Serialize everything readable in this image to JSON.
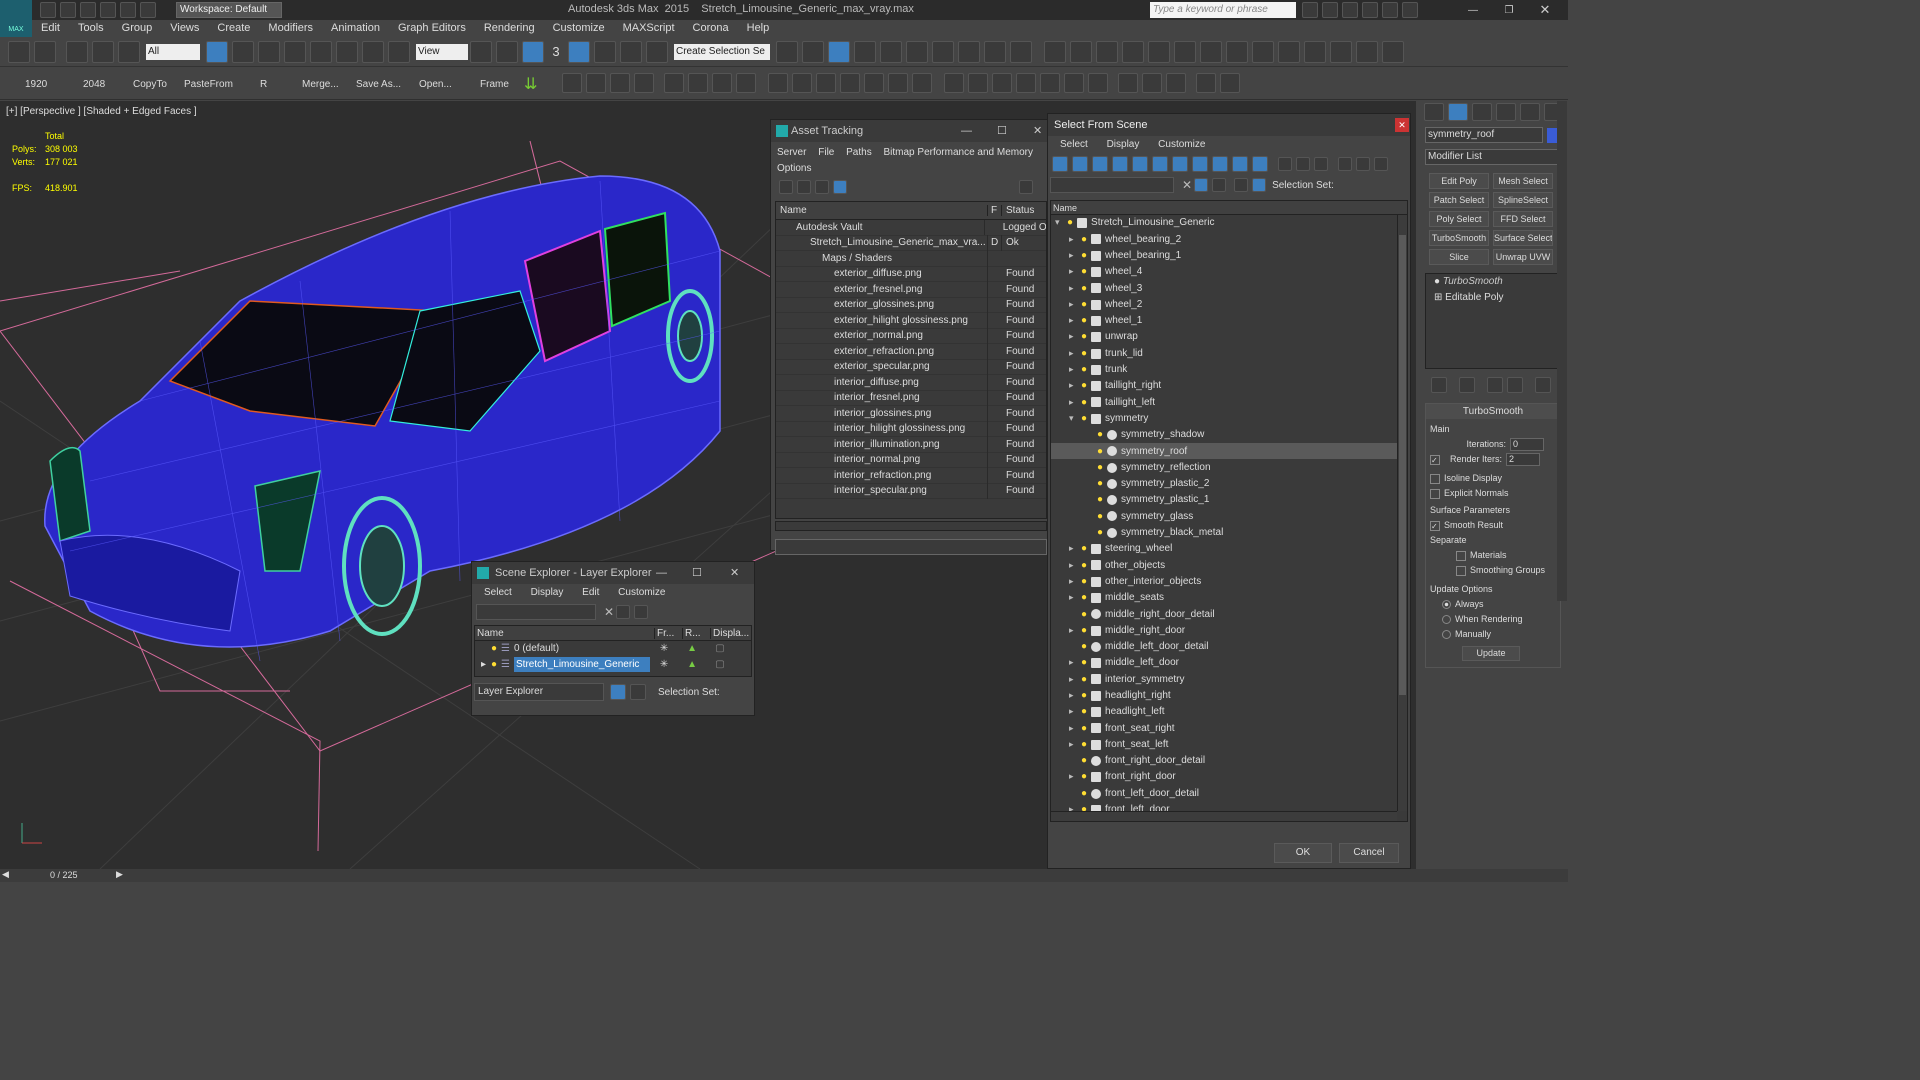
{
  "app": {
    "title": "Autodesk 3ds Max  2015    Stretch_Limousine_Generic_max_vray.max",
    "workspace": "Workspace: Default",
    "search_placeholder": "Type a keyword or phrase",
    "logo": "MAX"
  },
  "menu": [
    "Edit",
    "Tools",
    "Group",
    "Views",
    "Create",
    "Modifiers",
    "Animation",
    "Graph Editors",
    "Rendering",
    "Customize",
    "MAXScript",
    "Corona",
    "Help"
  ],
  "toolbar1": {
    "selection_filter": "All",
    "ref_coord": "View",
    "named_selection": "Create Selection Se",
    "snap_label": "3"
  },
  "toolbar2": {
    "items": [
      "1920",
      "2048",
      "CopyTo",
      "PasteFrom",
      "R",
      "Merge...",
      "Save As...",
      "Open...",
      "Frame"
    ]
  },
  "viewport": {
    "label": "[+] [Perspective ] [Shaded + Edged Faces ]",
    "stats": {
      "total_label": "Total",
      "polys_label": "Polys:",
      "polys": "308 003",
      "verts_label": "Verts:",
      "verts": "177 021",
      "fps_label": "FPS:",
      "fps": "418.901"
    }
  },
  "asset_tracking": {
    "title": "Asset Tracking",
    "menu": [
      "Server",
      "File",
      "Paths",
      "Bitmap Performance and Memory",
      "Options"
    ],
    "columns": [
      "Name",
      "F",
      "Status"
    ],
    "rows": [
      {
        "name": "Autodesk Vault",
        "f": "",
        "status": "Logged O"
      },
      {
        "name": "Stretch_Limousine_Generic_max_vra...",
        "f": "D",
        "status": "Ok"
      },
      {
        "name": "Maps / Shaders",
        "f": "",
        "status": ""
      },
      {
        "name": "exterior_diffuse.png",
        "f": "",
        "status": "Found"
      },
      {
        "name": "exterior_fresnel.png",
        "f": "",
        "status": "Found"
      },
      {
        "name": "exterior_glossines.png",
        "f": "",
        "status": "Found"
      },
      {
        "name": "exterior_hilight glossiness.png",
        "f": "",
        "status": "Found"
      },
      {
        "name": "exterior_normal.png",
        "f": "",
        "status": "Found"
      },
      {
        "name": "exterior_refraction.png",
        "f": "",
        "status": "Found"
      },
      {
        "name": "exterior_specular.png",
        "f": "",
        "status": "Found"
      },
      {
        "name": "interior_diffuse.png",
        "f": "",
        "status": "Found"
      },
      {
        "name": "interior_fresnel.png",
        "f": "",
        "status": "Found"
      },
      {
        "name": "interior_glossines.png",
        "f": "",
        "status": "Found"
      },
      {
        "name": "interior_hilight glossiness.png",
        "f": "",
        "status": "Found"
      },
      {
        "name": "interior_illumination.png",
        "f": "",
        "status": "Found"
      },
      {
        "name": "interior_normal.png",
        "f": "",
        "status": "Found"
      },
      {
        "name": "interior_refraction.png",
        "f": "",
        "status": "Found"
      },
      {
        "name": "interior_specular.png",
        "f": "",
        "status": "Found"
      }
    ]
  },
  "scene_explorer": {
    "title": "Scene Explorer - Layer Explorer",
    "menu": [
      "Select",
      "Display",
      "Edit",
      "Customize"
    ],
    "columns": [
      "Name",
      "Fr...",
      "R...",
      "Displa..."
    ],
    "rows": [
      "0 (default)",
      "Stretch_Limousine_Generic"
    ],
    "footer_mode": "Layer Explorer",
    "selection_set_label": "Selection Set:"
  },
  "select_from_scene": {
    "title": "Select From Scene",
    "menu": [
      "Select",
      "Display",
      "Customize"
    ],
    "selection_set_label": "Selection Set:",
    "column": "Name",
    "items": [
      {
        "name": "Stretch_Limousine_Generic",
        "level": 0,
        "exp": "v"
      },
      {
        "name": "wheel_bearing_2",
        "level": 1,
        "exp": ">"
      },
      {
        "name": "wheel_bearing_1",
        "level": 1,
        "exp": ">"
      },
      {
        "name": "wheel_4",
        "level": 1,
        "exp": ">"
      },
      {
        "name": "wheel_3",
        "level": 1,
        "exp": ">"
      },
      {
        "name": "wheel_2",
        "level": 1,
        "exp": ">"
      },
      {
        "name": "wheel_1",
        "level": 1,
        "exp": ">"
      },
      {
        "name": "unwrap",
        "level": 1,
        "exp": ">"
      },
      {
        "name": "trunk_lid",
        "level": 1,
        "exp": ">"
      },
      {
        "name": "trunk",
        "level": 1,
        "exp": ">"
      },
      {
        "name": "taillight_right",
        "level": 1,
        "exp": ">"
      },
      {
        "name": "taillight_left",
        "level": 1,
        "exp": ">"
      },
      {
        "name": "symmetry",
        "level": 1,
        "exp": "v"
      },
      {
        "name": "symmetry_shadow",
        "level": 2,
        "exp": ""
      },
      {
        "name": "symmetry_roof",
        "level": 2,
        "exp": "",
        "selected": true
      },
      {
        "name": "symmetry_reflection",
        "level": 2,
        "exp": ""
      },
      {
        "name": "symmetry_plastic_2",
        "level": 2,
        "exp": ""
      },
      {
        "name": "symmetry_plastic_1",
        "level": 2,
        "exp": ""
      },
      {
        "name": "symmetry_glass",
        "level": 2,
        "exp": ""
      },
      {
        "name": "symmetry_black_metal",
        "level": 2,
        "exp": ""
      },
      {
        "name": "steering_wheel",
        "level": 1,
        "exp": ">"
      },
      {
        "name": "other_objects",
        "level": 1,
        "exp": ">"
      },
      {
        "name": "other_interior_objects",
        "level": 1,
        "exp": ">"
      },
      {
        "name": "middle_seats",
        "level": 1,
        "exp": ">"
      },
      {
        "name": "middle_right_door_detail",
        "level": 1,
        "exp": ""
      },
      {
        "name": "middle_right_door",
        "level": 1,
        "exp": ">"
      },
      {
        "name": "middle_left_door_detail",
        "level": 1,
        "exp": ""
      },
      {
        "name": "middle_left_door",
        "level": 1,
        "exp": ">"
      },
      {
        "name": "interior_symmetry",
        "level": 1,
        "exp": ">"
      },
      {
        "name": "headlight_right",
        "level": 1,
        "exp": ">"
      },
      {
        "name": "headlight_left",
        "level": 1,
        "exp": ">"
      },
      {
        "name": "front_seat_right",
        "level": 1,
        "exp": ">"
      },
      {
        "name": "front_seat_left",
        "level": 1,
        "exp": ">"
      },
      {
        "name": "front_right_door_detail",
        "level": 1,
        "exp": ""
      },
      {
        "name": "front_right_door",
        "level": 1,
        "exp": ">"
      },
      {
        "name": "front_left_door_detail",
        "level": 1,
        "exp": ""
      },
      {
        "name": "front_left_door",
        "level": 1,
        "exp": ">"
      }
    ],
    "ok": "OK",
    "cancel": "Cancel"
  },
  "command_panel": {
    "object_name": "symmetry_roof",
    "modifier_list": "Modifier List",
    "buttons": [
      [
        "Edit Poly",
        "Mesh Select"
      ],
      [
        "Patch Select",
        "SplineSelect"
      ],
      [
        "Poly Select",
        "FFD Select"
      ],
      [
        "TurboSmooth",
        "Surface Select"
      ],
      [
        "Slice",
        "Unwrap UVW"
      ]
    ],
    "stack": [
      "TurboSmooth",
      "Editable Poly"
    ],
    "rollout_title": "TurboSmooth",
    "main_label": "Main",
    "iterations_label": "Iterations:",
    "iterations": "0",
    "render_iters_label": "Render Iters:",
    "render_iters": "2",
    "isoline": "Isoline Display",
    "explicit_normals": "Explicit Normals",
    "surface_params": "Surface Parameters",
    "smooth_result": "Smooth Result",
    "separate": "Separate",
    "materials": "Materials",
    "smoothing_groups": "Smoothing Groups",
    "update_options": "Update Options",
    "always": "Always",
    "when_rendering": "When Rendering",
    "manually": "Manually",
    "update_btn": "Update"
  },
  "status": {
    "frame": "0 / 225"
  }
}
